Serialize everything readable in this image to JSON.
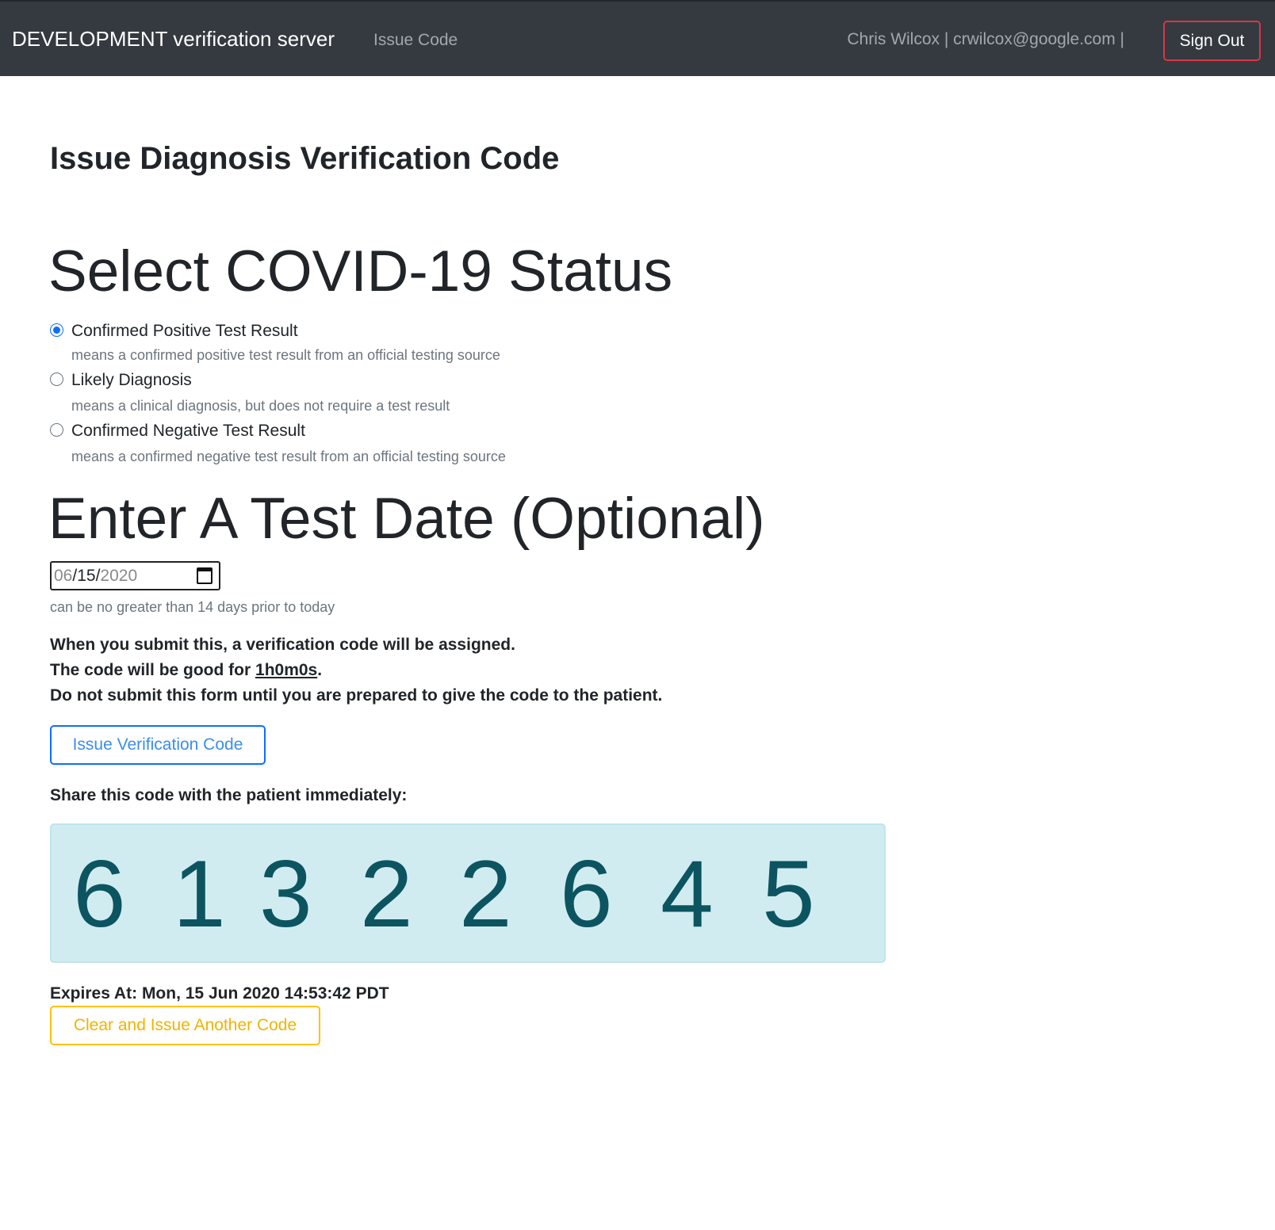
{
  "navbar": {
    "brand": "DEVELOPMENT verification server",
    "nav_link": "Issue Code",
    "user_info": "Chris Wilcox | crwilcox@google.com |",
    "sign_out_label": "Sign Out"
  },
  "page": {
    "title": "Issue Diagnosis Verification Code"
  },
  "status_section": {
    "heading": "Select COVID-19 Status",
    "options": [
      {
        "label": "Confirmed Positive Test Result",
        "help": "means a confirmed positive test result from an official testing source",
        "selected": true
      },
      {
        "label": "Likely Diagnosis",
        "help": "means a clinical diagnosis, but does not require a test result",
        "selected": false
      },
      {
        "label": "Confirmed Negative Test Result",
        "help": "means a confirmed negative test result from an official testing source",
        "selected": false
      }
    ]
  },
  "date_section": {
    "heading": "Enter A Test Date (Optional)",
    "month": "06",
    "day": "15",
    "year": "2020",
    "help": "can be no greater than 14 days prior to today"
  },
  "notice": {
    "line1": "When you submit this, a verification code will be assigned.",
    "line2_prefix": "The code will be good for ",
    "line2_duration": "1h0m0s",
    "line2_suffix": ".",
    "line3": "Do not submit this form until you are prepared to give the code to the patient."
  },
  "issue_button_label": "Issue Verification Code",
  "share_label": "Share this code with the patient immediately:",
  "code": {
    "digits": [
      "6",
      "1",
      "3",
      "2",
      "2",
      "6",
      "4",
      "5"
    ]
  },
  "expires": {
    "label": "Expires At:",
    "value": "Mon, 15 Jun 2020 14:53:42 PDT"
  },
  "clear_button_label": "Clear and Issue Another Code",
  "colors": {
    "navbar_bg": "#343a40",
    "sign_out_border": "#dc3545",
    "primary": "#0d6efd",
    "code_bg": "#d1ecf1",
    "code_text": "#0c5460",
    "warning": "#ffc107"
  }
}
